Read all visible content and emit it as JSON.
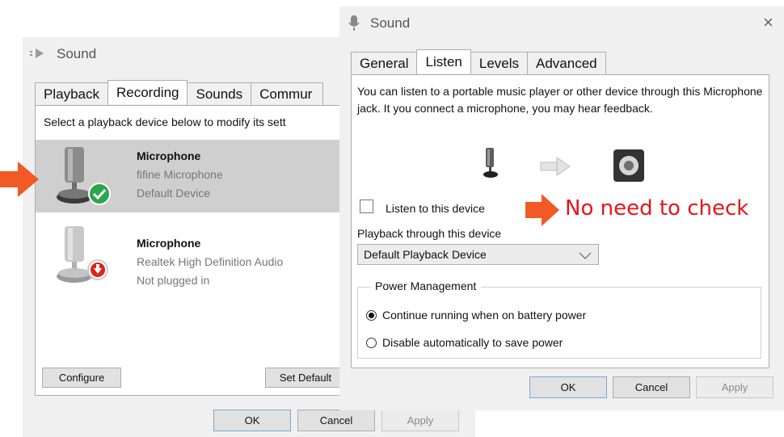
{
  "back_window": {
    "title": "Sound",
    "tabs": [
      "Playback",
      "Recording",
      "Sounds",
      "Commur"
    ],
    "active_tab": "Recording",
    "instruction": "Select a playback device below to modify its sett",
    "devices": [
      {
        "name": "Microphone",
        "line1": "fifine Microphone",
        "line2": "Default Device",
        "status": "default",
        "selected": true
      },
      {
        "name": "Microphone",
        "line1": "Realtek High Definition Audio",
        "line2": "Not plugged in",
        "status": "unplugged",
        "selected": false
      }
    ],
    "configure_label": "Configure",
    "set_default_label": "Set Default",
    "ok_label": "OK",
    "cancel_label": "Cancel",
    "apply_label": "Apply"
  },
  "front_window": {
    "title": "Sound",
    "close_glyph": "×",
    "tabs": [
      "General",
      "Listen",
      "Levels",
      "Advanced"
    ],
    "active_tab": "Listen",
    "description": "You can listen to a portable music player or other device through this Microphone jack. It you connect a microphone, you may hear feedback.",
    "listen_checkbox_label": "Listen to this device",
    "listen_checked": false,
    "playback_label": "Playback through this device",
    "playback_value": "Default Playback Device",
    "power_group_title": "Power Management",
    "power_options": [
      {
        "label": "Continue running when on battery power",
        "selected": true
      },
      {
        "label": "Disable automatically to save power",
        "selected": false
      }
    ],
    "ok_label": "OK",
    "cancel_label": "Cancel",
    "apply_label": "Apply"
  },
  "annotation": {
    "text": "No need to check",
    "color": "#e8141c",
    "arrow_color": "#f15a24"
  },
  "colors": {
    "selection": "#cfcfcf",
    "green_check": "#2ea44f",
    "red_badge": "#d9261c"
  }
}
